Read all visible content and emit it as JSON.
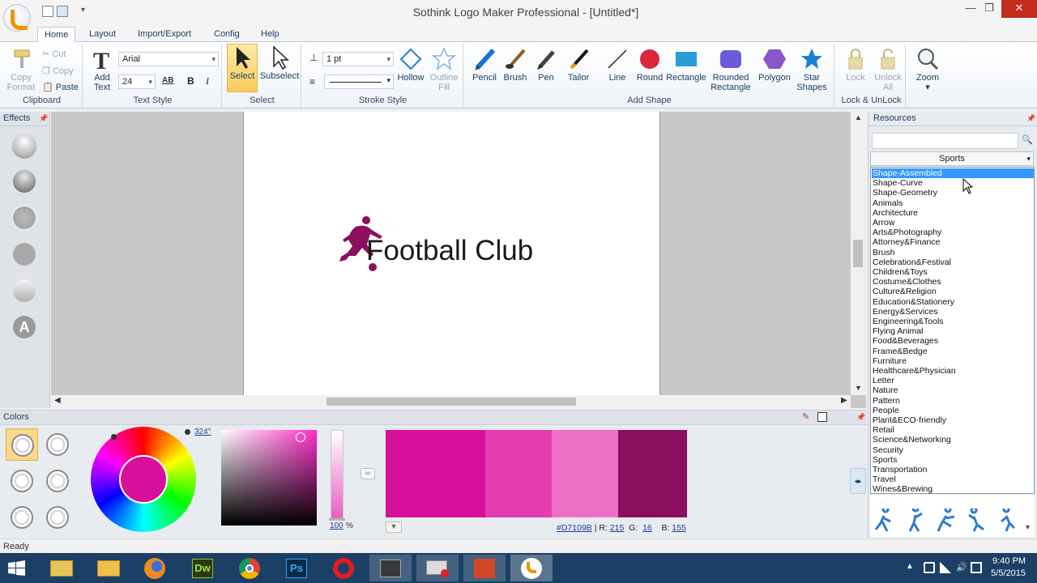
{
  "window": {
    "title": "Sothink Logo Maker Professional - [Untitled*]",
    "minimize": "—",
    "restore": "❐",
    "close": "✕"
  },
  "tabs": [
    "Home",
    "Layout",
    "Import/Export",
    "Config",
    "Help"
  ],
  "ribbon": {
    "clipboard": {
      "label": "Clipboard",
      "copy_format_1": "Copy",
      "copy_format_2": "Format",
      "cut": "Cut",
      "copy": "Copy",
      "paste": "Paste"
    },
    "text_style": {
      "label": "Text Style",
      "add_text_1": "Add",
      "add_text_2": "Text",
      "font": "Arial",
      "size": "24",
      "bold": "B",
      "italic": "I",
      "spacing": "AB"
    },
    "select": {
      "label": "Select",
      "select": "Select",
      "subselect": "Subselect"
    },
    "stroke": {
      "label": "Stroke Style",
      "width": "1 pt",
      "hollow": "Hollow",
      "outline_1": "Outline",
      "outline_2": "Fill"
    },
    "add_shape": {
      "label": "Add Shape",
      "pencil": "Pencil",
      "brush": "Brush",
      "pen": "Pen",
      "tailor": "Tailor",
      "line": "Line",
      "round": "Round",
      "rectangle": "Rectangle",
      "rounded_1": "Rounded",
      "rounded_2": "Rectangle",
      "polygon": "Polygon",
      "star_1": "Star",
      "star_2": "Shapes"
    },
    "lock": {
      "label": "Lock & UnLock",
      "lock": "Lock",
      "unlock_1": "Unlock",
      "unlock_2": "All"
    },
    "zoom": {
      "zoom": "Zoom"
    }
  },
  "effects": {
    "title": "Effects",
    "text_effect_glyph": "A"
  },
  "canvas": {
    "logo_text": "Football Club",
    "logo_color": "#8b0f5e"
  },
  "colors": {
    "title": "Colors",
    "hue": "324°",
    "alpha": "100",
    "alpha_unit": "%",
    "hex": "#D7109B",
    "r_label": "R:",
    "r": "215",
    "g_label": "G:",
    "g": "16",
    "b_label": "B:",
    "b": "155",
    "swatches": [
      "#d7109b",
      "#e43db0",
      "#ee6fc6",
      "#8b0f5e"
    ]
  },
  "resources": {
    "title": "Resources",
    "search_placeholder": "",
    "category": "Sports",
    "dropdown": [
      "Shape-Assembled",
      "Shape-Curve",
      "Shape-Geometry",
      "Animals",
      "Architecture",
      "Arrow",
      "Arts&Photography",
      "Attorney&Finance",
      "Brush",
      "Celebration&Festival",
      "Children&Toys",
      "Costume&Clothes",
      "Culture&Religion",
      "Education&Stationery",
      "Energy&Services",
      "Engineering&Tools",
      "Flying Animal",
      "Food&Beverages",
      "Frame&Bedge",
      "Furniture",
      "Healthcare&Physician",
      "Letter",
      "Nature",
      "Pattern",
      "People",
      "Plant&ECO-friendly",
      "Retail",
      "Science&Networking",
      "Security",
      "Sports",
      "Transportation",
      "Travel",
      "Wines&Brewing"
    ],
    "selected_index": 0
  },
  "status": {
    "text": "Ready"
  },
  "taskbar": {
    "time": "9:40 PM",
    "date": "5/5/2015",
    "dw_label": "Dw",
    "ps_label": "Ps"
  }
}
